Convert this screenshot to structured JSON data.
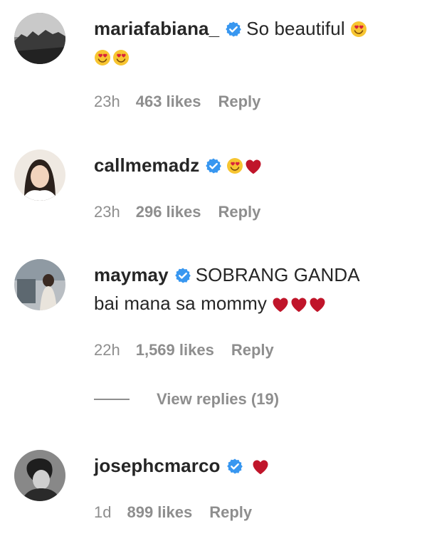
{
  "comments": [
    {
      "username": "mariafabiana_",
      "text": "So beautiful",
      "time": "23h",
      "likes": "463 likes",
      "reply": "Reply"
    },
    {
      "username": "callmemadz",
      "text": "",
      "time": "23h",
      "likes": "296 likes",
      "reply": "Reply"
    },
    {
      "username": "maymay",
      "text_line1": "SOBRANG GANDA",
      "text_line2": "bai mana sa mommy",
      "time": "22h",
      "likes": "1,569 likes",
      "reply": "Reply",
      "view_replies": "View replies (19)"
    },
    {
      "username": "josephcmarco",
      "text": "",
      "time": "1d",
      "likes": "899 likes",
      "reply": "Reply"
    }
  ],
  "colors": {
    "verified": "#3897f0",
    "heart": "#c0152a",
    "emoji_face": "#f7c531",
    "meta": "#8e8e8e"
  }
}
